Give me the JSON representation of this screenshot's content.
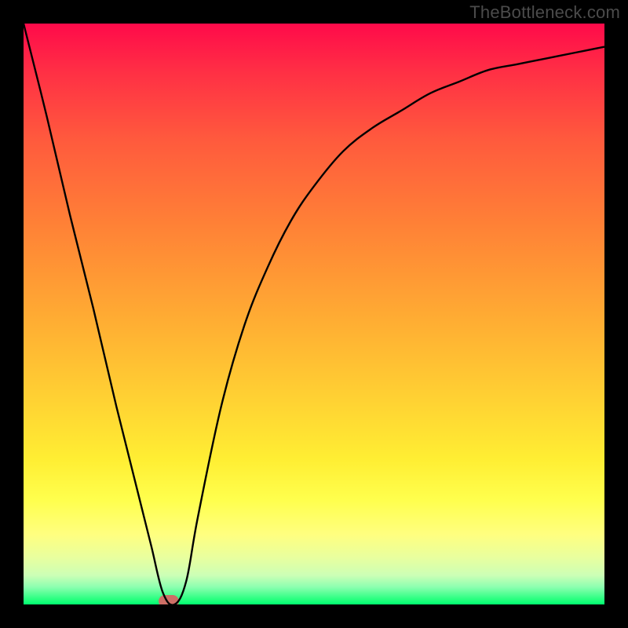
{
  "watermark": "TheBottleneck.com",
  "chart_data": {
    "type": "line",
    "title": "",
    "xlabel": "",
    "ylabel": "",
    "xlim": [
      0,
      1
    ],
    "ylim": [
      0,
      1
    ],
    "series": [
      {
        "name": "curve",
        "x": [
          0.0,
          0.04,
          0.08,
          0.12,
          0.16,
          0.2,
          0.22,
          0.24,
          0.26,
          0.28,
          0.3,
          0.34,
          0.38,
          0.42,
          0.46,
          0.5,
          0.55,
          0.6,
          0.65,
          0.7,
          0.75,
          0.8,
          0.85,
          0.9,
          0.95,
          1.0
        ],
        "values": [
          1.0,
          0.84,
          0.67,
          0.51,
          0.34,
          0.18,
          0.1,
          0.02,
          0.0,
          0.04,
          0.15,
          0.34,
          0.48,
          0.58,
          0.66,
          0.72,
          0.78,
          0.82,
          0.85,
          0.88,
          0.9,
          0.92,
          0.93,
          0.94,
          0.95,
          0.96
        ]
      }
    ],
    "marker": {
      "x": 0.25,
      "y": 0.0
    },
    "gradient_colors": [
      "#ff0a4a",
      "#ff2e45",
      "#ff5a3d",
      "#ff8236",
      "#ffaa33",
      "#ffd533",
      "#ffee33",
      "#ffff4d",
      "#ffff80",
      "#e8ff9f",
      "#ccffb6",
      "#8cffb0",
      "#2dff82",
      "#00ff6f"
    ],
    "marker_color": "#cd6f66"
  }
}
